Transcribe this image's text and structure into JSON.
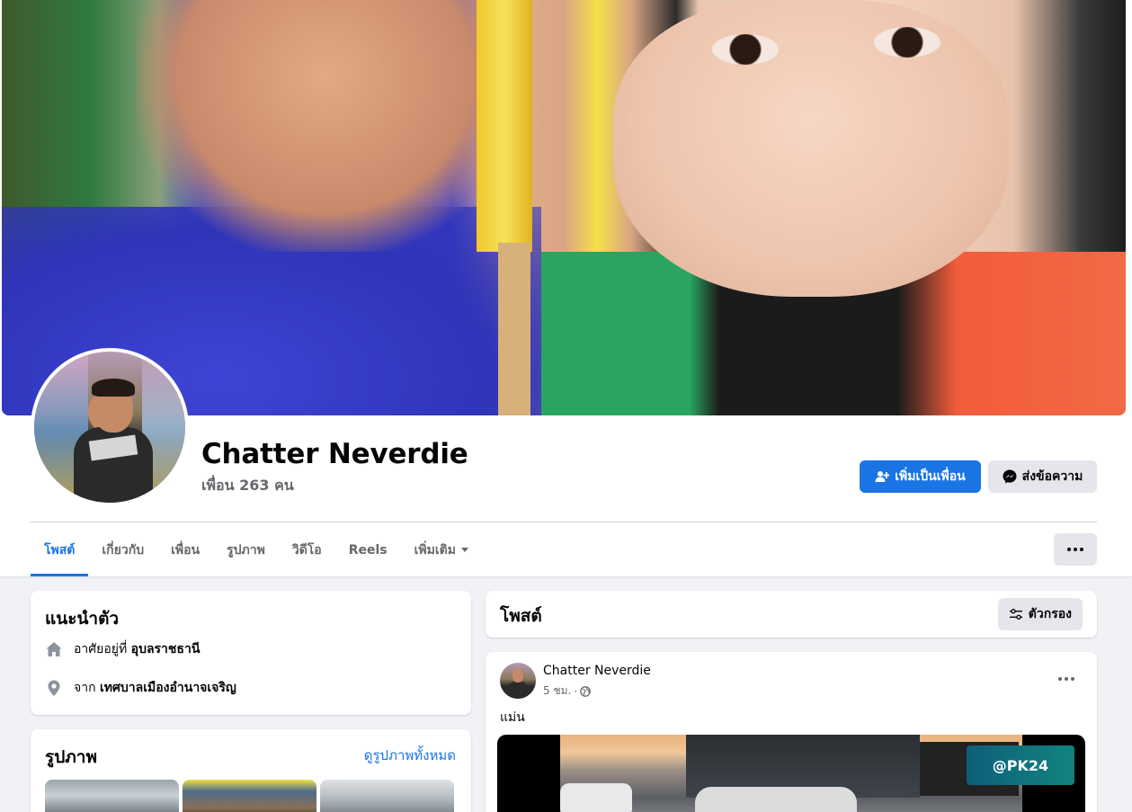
{
  "profile": {
    "name": "Chatter Neverdie",
    "friends": "เพื่อน 263 คน",
    "add_friend": "เพิ่มเป็นเพื่อน",
    "message": "ส่งข้อความ"
  },
  "tabs": [
    {
      "label": "โพสต์",
      "active": true
    },
    {
      "label": "เกี่ยวกับ",
      "active": false
    },
    {
      "label": "เพื่อน",
      "active": false
    },
    {
      "label": "รูปภาพ",
      "active": false
    },
    {
      "label": "วิดีโอ",
      "active": false
    },
    {
      "label": "Reels",
      "active": false
    },
    {
      "label": "เพิ่มเติม",
      "active": false
    }
  ],
  "intro": {
    "title": "แนะนำตัว",
    "lives_prefix": "อาศัยอยู่ที่",
    "lives_value": "อุบลราชธานี",
    "from_prefix": "จาก",
    "from_value": "เทศบาลเมืองอำนาจเจริญ"
  },
  "photos": {
    "title": "รูปภาพ",
    "see_all": "ดูรูปภาพทั้งหมด"
  },
  "posts": {
    "title": "โพสต์",
    "filter": "ตัวกรอง"
  },
  "post": {
    "author": "Chatter Neverdie",
    "time": "5 ชม.",
    "separator": "·",
    "text": "แม่น",
    "media_sign": "@PK24"
  },
  "colors": {
    "accent": "#1b74e4",
    "page_bg": "#f0f2f5",
    "secondary_btn": "#e4e6eb",
    "muted_text": "#65676b"
  }
}
